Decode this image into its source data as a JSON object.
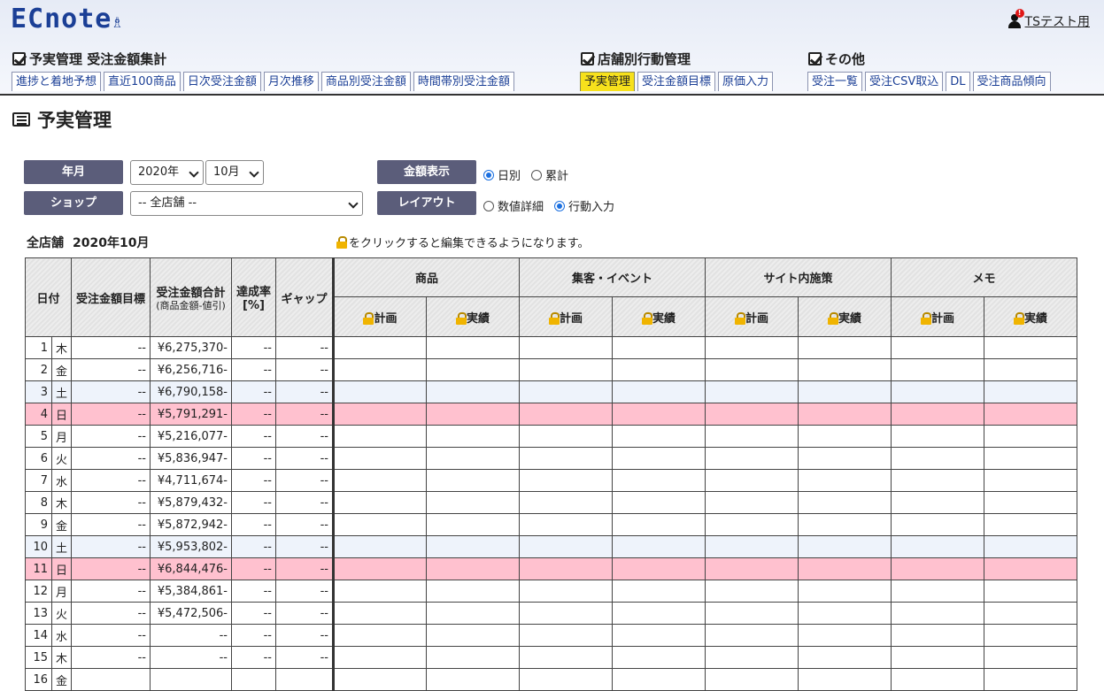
{
  "logo": "ECnote",
  "user": {
    "name": "TSテスト用",
    "badge": "!"
  },
  "nav": {
    "groups": [
      {
        "title": "予実管理 受注金額集計"
      },
      {
        "title": "店舗別行動管理"
      },
      {
        "title": "その他"
      }
    ],
    "tabs": [
      "進捗と着地予想",
      "直近100商品",
      "日次受注金額",
      "月次推移",
      "商品別受注金額",
      "時間帯別受注金額",
      "予実管理",
      "受注金額目標",
      "原価入力",
      "受注一覧",
      "受注CSV取込",
      "DL",
      "受注商品傾向"
    ]
  },
  "page_title": "予実管理",
  "controls": {
    "year_month_label": "年月",
    "year_value": "2020年",
    "month_value": "10月",
    "shop_label": "ショップ",
    "shop_value": "-- 全店舗 --",
    "amount_label": "金額表示",
    "amount_options": [
      "日別",
      "累計"
    ],
    "layout_label": "レイアウト",
    "layout_options": [
      "数値詳細",
      "行動入力"
    ]
  },
  "summary": {
    "shop": "全店舗",
    "period": "2020年10月"
  },
  "note": "をクリックすると編集できるようになります。",
  "table": {
    "headers": {
      "date": "日付",
      "target": "受注金額目標",
      "total": "受注金額合計",
      "total_sub": "(商品金額-値引)",
      "rate": "達成率[%]",
      "gap": "ギャップ",
      "groups": [
        "商品",
        "集客・イベント",
        "サイト内施策",
        "メモ"
      ],
      "plan": "計画",
      "actual": "実績"
    },
    "rows": [
      {
        "day": "1",
        "wd": "木",
        "target": "--",
        "total": "¥6,275,370-",
        "rate": "--",
        "gap": "--",
        "type": ""
      },
      {
        "day": "2",
        "wd": "金",
        "target": "--",
        "total": "¥6,256,716-",
        "rate": "--",
        "gap": "--",
        "type": ""
      },
      {
        "day": "3",
        "wd": "土",
        "target": "--",
        "total": "¥6,790,158-",
        "rate": "--",
        "gap": "--",
        "type": "sat"
      },
      {
        "day": "4",
        "wd": "日",
        "target": "--",
        "total": "¥5,791,291-",
        "rate": "--",
        "gap": "--",
        "type": "sun"
      },
      {
        "day": "5",
        "wd": "月",
        "target": "--",
        "total": "¥5,216,077-",
        "rate": "--",
        "gap": "--",
        "type": ""
      },
      {
        "day": "6",
        "wd": "火",
        "target": "--",
        "total": "¥5,836,947-",
        "rate": "--",
        "gap": "--",
        "type": ""
      },
      {
        "day": "7",
        "wd": "水",
        "target": "--",
        "total": "¥4,711,674-",
        "rate": "--",
        "gap": "--",
        "type": ""
      },
      {
        "day": "8",
        "wd": "木",
        "target": "--",
        "total": "¥5,879,432-",
        "rate": "--",
        "gap": "--",
        "type": ""
      },
      {
        "day": "9",
        "wd": "金",
        "target": "--",
        "total": "¥5,872,942-",
        "rate": "--",
        "gap": "--",
        "type": ""
      },
      {
        "day": "10",
        "wd": "土",
        "target": "--",
        "total": "¥5,953,802-",
        "rate": "--",
        "gap": "--",
        "type": "sat"
      },
      {
        "day": "11",
        "wd": "日",
        "target": "--",
        "total": "¥6,844,476-",
        "rate": "--",
        "gap": "--",
        "type": "sun"
      },
      {
        "day": "12",
        "wd": "月",
        "target": "--",
        "total": "¥5,384,861-",
        "rate": "--",
        "gap": "--",
        "type": ""
      },
      {
        "day": "13",
        "wd": "火",
        "target": "--",
        "total": "¥5,472,506-",
        "rate": "--",
        "gap": "--",
        "type": ""
      },
      {
        "day": "14",
        "wd": "水",
        "target": "--",
        "total": "--",
        "rate": "--",
        "gap": "--",
        "type": ""
      },
      {
        "day": "15",
        "wd": "木",
        "target": "--",
        "total": "--",
        "rate": "--",
        "gap": "--",
        "type": ""
      },
      {
        "day": "16",
        "wd": "金",
        "target": "",
        "total": "",
        "rate": "",
        "gap": "",
        "type": ""
      }
    ]
  }
}
